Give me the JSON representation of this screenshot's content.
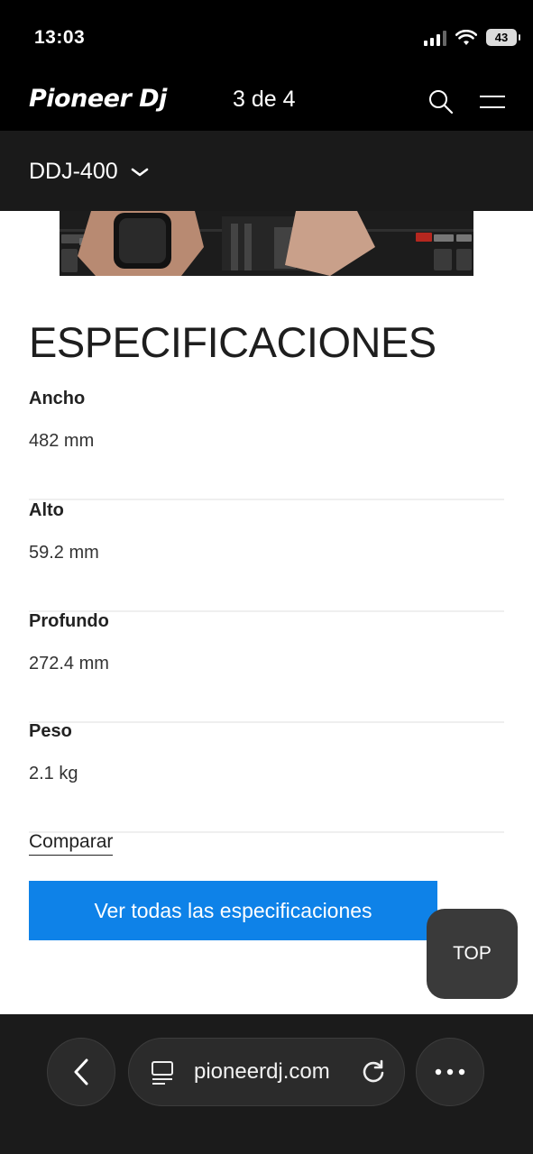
{
  "status_bar": {
    "time": "13:03",
    "battery": "43"
  },
  "header": {
    "logo": "Pioneer Dj",
    "page_counter": "3 de 4",
    "icons": [
      "search-icon",
      "hamburger-menu-icon"
    ]
  },
  "sub_nav": {
    "product": "DDJ-400"
  },
  "specs": {
    "title": "ESPECIFICACIONES",
    "items": [
      {
        "label": "Ancho",
        "value": "482 mm"
      },
      {
        "label": "Alto",
        "value": "59.2 mm"
      },
      {
        "label": "Profundo",
        "value": "272.4 mm"
      },
      {
        "label": "Peso",
        "value": "2.1 kg"
      }
    ],
    "compare_label": "Comparar",
    "view_all_label": "Ver todas las especificaciones"
  },
  "top_button": "TOP",
  "browser": {
    "url": "pioneerdj.com",
    "icons": [
      "back-icon",
      "reader-icon",
      "reload-icon",
      "more-icon"
    ]
  },
  "colors": {
    "accent_blue": "#0e82e8",
    "header_bg": "#000000",
    "subnav_bg": "#1a1a1a",
    "top_button_bg": "#3a3a3a"
  }
}
